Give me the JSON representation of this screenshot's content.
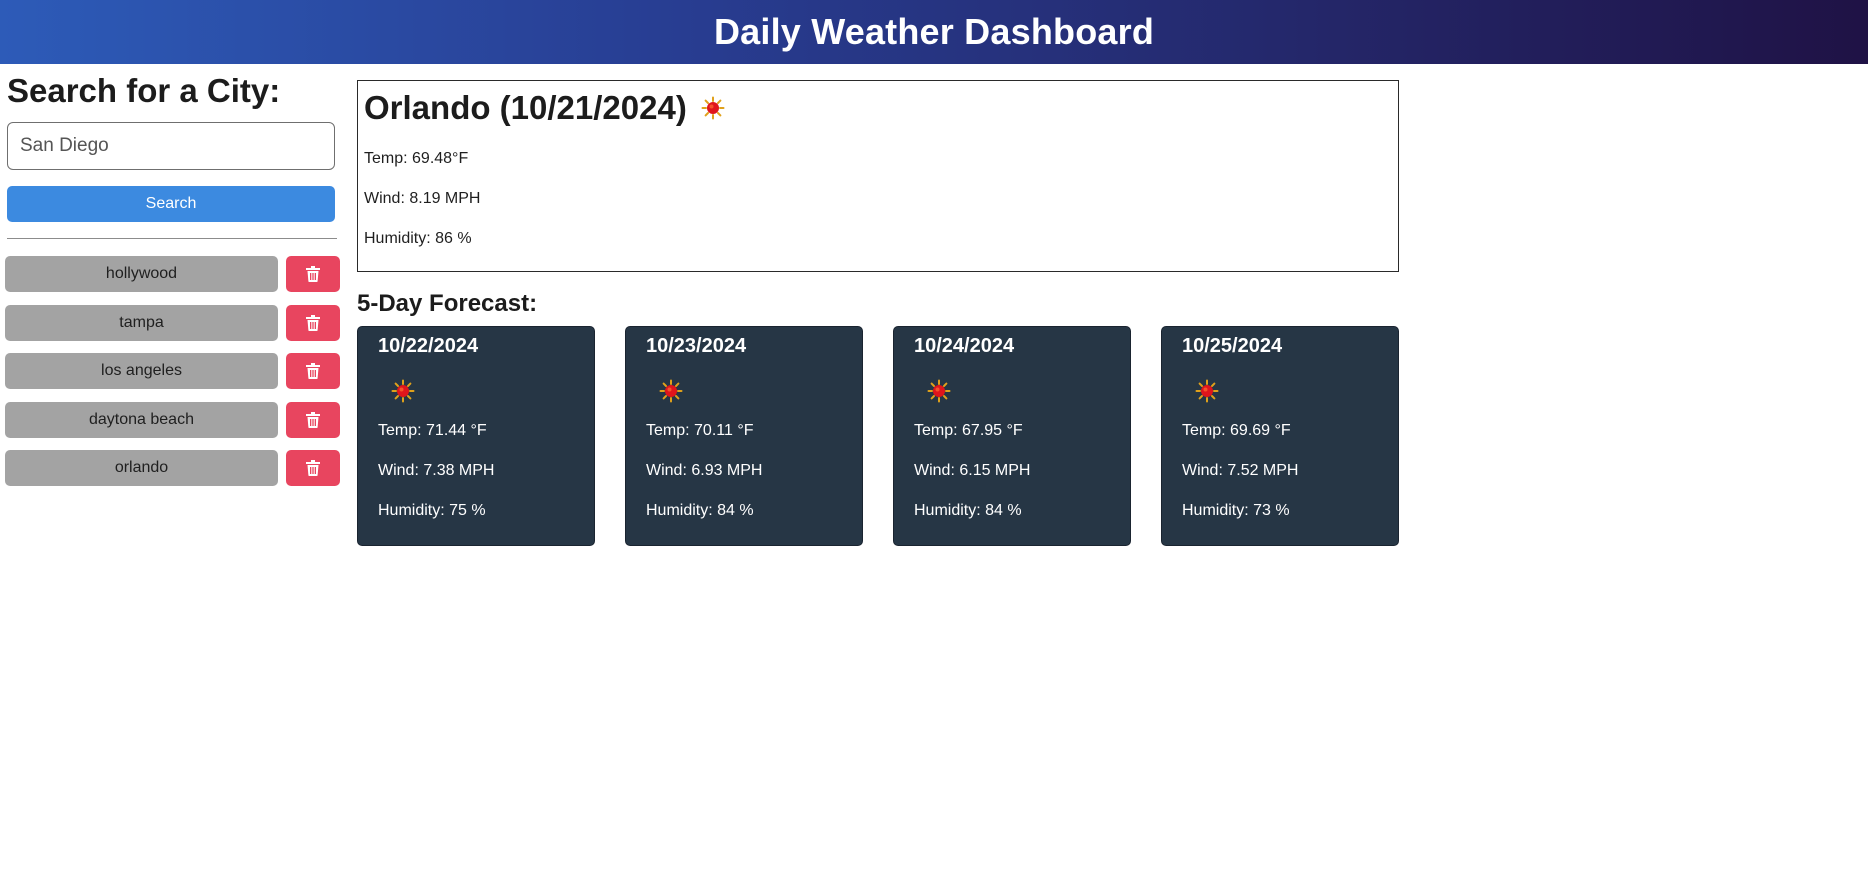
{
  "header": {
    "title": "Daily Weather Dashboard"
  },
  "search": {
    "title": "Search for a City:",
    "input_value": "San Diego",
    "button_label": "Search"
  },
  "history": [
    {
      "city": "hollywood"
    },
    {
      "city": "tampa"
    },
    {
      "city": "los angeles"
    },
    {
      "city": "daytona beach"
    },
    {
      "city": "orlando"
    }
  ],
  "current": {
    "title": "Orlando (10/21/2024)",
    "icon": "sun-icon",
    "temp": "Temp: 69.48°F",
    "wind": "Wind: 8.19 MPH",
    "humidity": "Humidity: 86 %"
  },
  "forecast": {
    "title": "5-Day Forecast:",
    "days": [
      {
        "date": "10/22/2024",
        "icon": "sun-icon",
        "temp": "Temp: 71.44 °F",
        "wind": "Wind: 7.38 MPH",
        "humidity": "Humidity: 75 %"
      },
      {
        "date": "10/23/2024",
        "icon": "sun-icon",
        "temp": "Temp: 70.11 °F",
        "wind": "Wind: 6.93 MPH",
        "humidity": "Humidity: 84 %"
      },
      {
        "date": "10/24/2024",
        "icon": "sun-icon",
        "temp": "Temp: 67.95 °F",
        "wind": "Wind: 6.15 MPH",
        "humidity": "Humidity: 84 %"
      },
      {
        "date": "10/25/2024",
        "icon": "sun-icon",
        "temp": "Temp: 69.69 °F",
        "wind": "Wind: 7.52 MPH",
        "humidity": "Humidity: 73 %"
      }
    ]
  },
  "colors": {
    "header_gradient_start": "#2d5bb8",
    "header_gradient_end": "#1f1245",
    "search_button": "#3c8ae0",
    "city_button": "#a3a3a3",
    "delete_button": "#e8455f",
    "card_background": "#263645"
  }
}
